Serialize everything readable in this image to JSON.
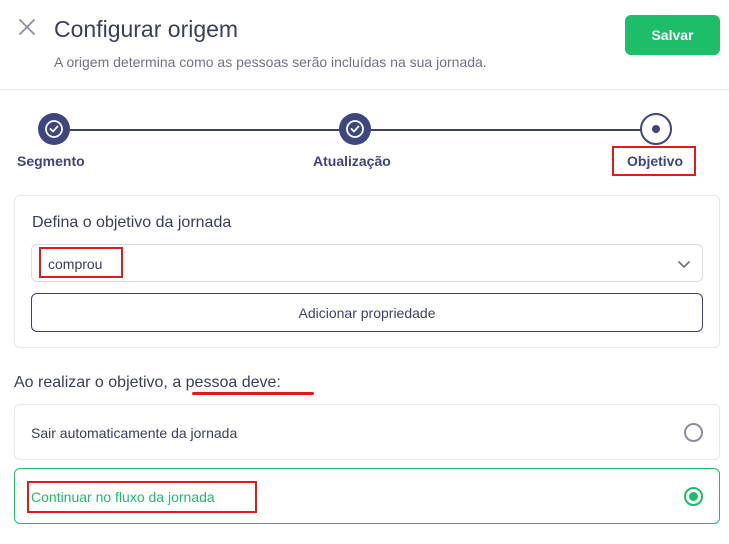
{
  "header": {
    "title": "Configurar origem",
    "subtitle": "A origem determina como as pessoas serão incluídas na sua jornada.",
    "save_label": "Salvar",
    "close_icon": "close-icon"
  },
  "stepper": {
    "steps": [
      {
        "label": "Segmento",
        "status": "completed",
        "icon": "check-icon"
      },
      {
        "label": "Atualização",
        "status": "completed",
        "icon": "check-icon"
      },
      {
        "label": "Objetivo",
        "status": "current",
        "icon": "dot-icon"
      }
    ]
  },
  "objective": {
    "heading": "Defina o objetivo da jornada",
    "selected_value": "comprou",
    "add_property_label": "Adicionar propriedade"
  },
  "outcome": {
    "question_prefix": "Ao realizar o objetivo, ",
    "question_emphasis": "a pessoa deve:",
    "options": [
      {
        "label": "Sair automaticamente da jornada",
        "selected": false
      },
      {
        "label": "Continuar no fluxo da jornada",
        "selected": true
      }
    ]
  },
  "colors": {
    "primary_green": "#1ebd6a",
    "navy": "#3e4580",
    "highlight_red": "#e01b1b"
  }
}
